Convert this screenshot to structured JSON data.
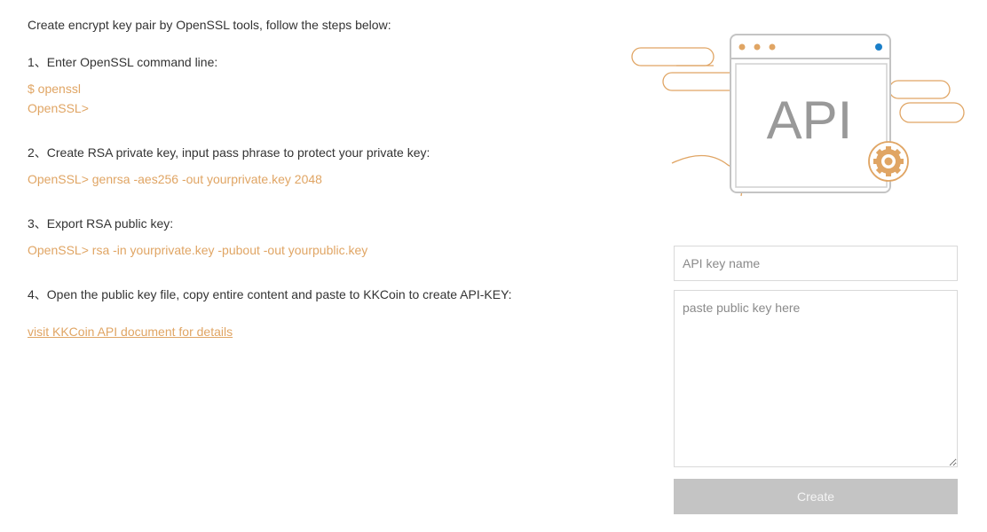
{
  "instructions": {
    "intro": "Create encrypt key pair by OpenSSL tools, follow the steps below:",
    "steps": [
      {
        "title": "1、Enter OpenSSL command line:",
        "code": [
          "$ openssl",
          "OpenSSL>"
        ]
      },
      {
        "title": "2、Create RSA private key, input pass phrase to protect your private key:",
        "code": [
          "OpenSSL> genrsa -aes256 -out yourprivate.key 2048"
        ]
      },
      {
        "title": "3、Export RSA public key:",
        "code": [
          "OpenSSL> rsa -in yourprivate.key -pubout -out yourpublic.key"
        ]
      },
      {
        "title": "4、Open the public key file, copy entire content and paste to KKCoin to create API-KEY:",
        "code": []
      }
    ],
    "doc_link": "visit KKCoin API document for details"
  },
  "illustration": {
    "label": "API",
    "icon": "gear-icon"
  },
  "form": {
    "key_name_placeholder": "API key name",
    "public_key_placeholder": "paste public key here",
    "create_label": "Create"
  },
  "colors": {
    "accent": "#e0a564",
    "text": "#333333",
    "button_disabled": "#c4c4c4",
    "window_dot_blue": "#1a7fc9"
  }
}
